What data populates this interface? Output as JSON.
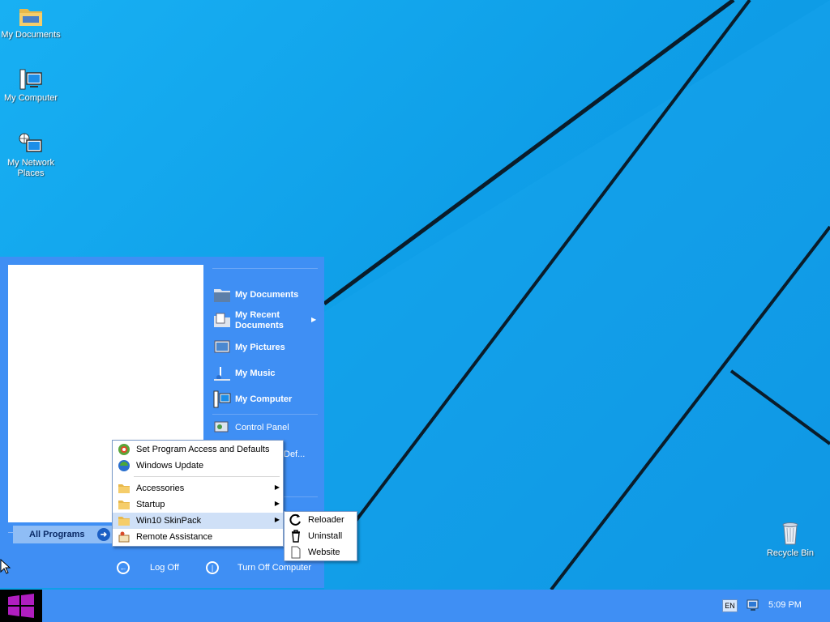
{
  "desktop": {
    "icons": [
      {
        "label": "My Documents",
        "icon": "folder-icon"
      },
      {
        "label": "My Computer",
        "icon": "computer-icon"
      },
      {
        "label": "My Network Places",
        "icon": "network-icon"
      },
      {
        "label": "Recycle Bin",
        "icon": "recycle-bin-icon"
      }
    ]
  },
  "start_menu": {
    "right_items": [
      {
        "label": "My Documents"
      },
      {
        "label": "My Recent Documents"
      },
      {
        "label": "My Pictures"
      },
      {
        "label": "My Music"
      },
      {
        "label": "My Computer"
      },
      {
        "label": "Control Panel"
      },
      {
        "label": "Def..."
      }
    ],
    "all_programs": "All Programs",
    "log_off": "Log Off",
    "turn_off": "Turn Off Computer"
  },
  "programs_menu": {
    "items": [
      {
        "label": "Set Program Access and Defaults"
      },
      {
        "label": "Windows Update"
      },
      {
        "label": "Accessories"
      },
      {
        "label": "Startup"
      },
      {
        "label": "Win10 SkinPack"
      },
      {
        "label": "Remote Assistance"
      }
    ]
  },
  "skinpack_menu": {
    "items": [
      {
        "label": "Reloader"
      },
      {
        "label": "Uninstall"
      },
      {
        "label": "Website"
      }
    ]
  },
  "taskbar": {
    "language": "EN",
    "clock": "5:09 PM"
  },
  "colors": {
    "accent": "#3f8ff4",
    "wallpaper": "#0fa2ea",
    "start_button": "#000000",
    "windows_logo": "#b01ec0"
  }
}
